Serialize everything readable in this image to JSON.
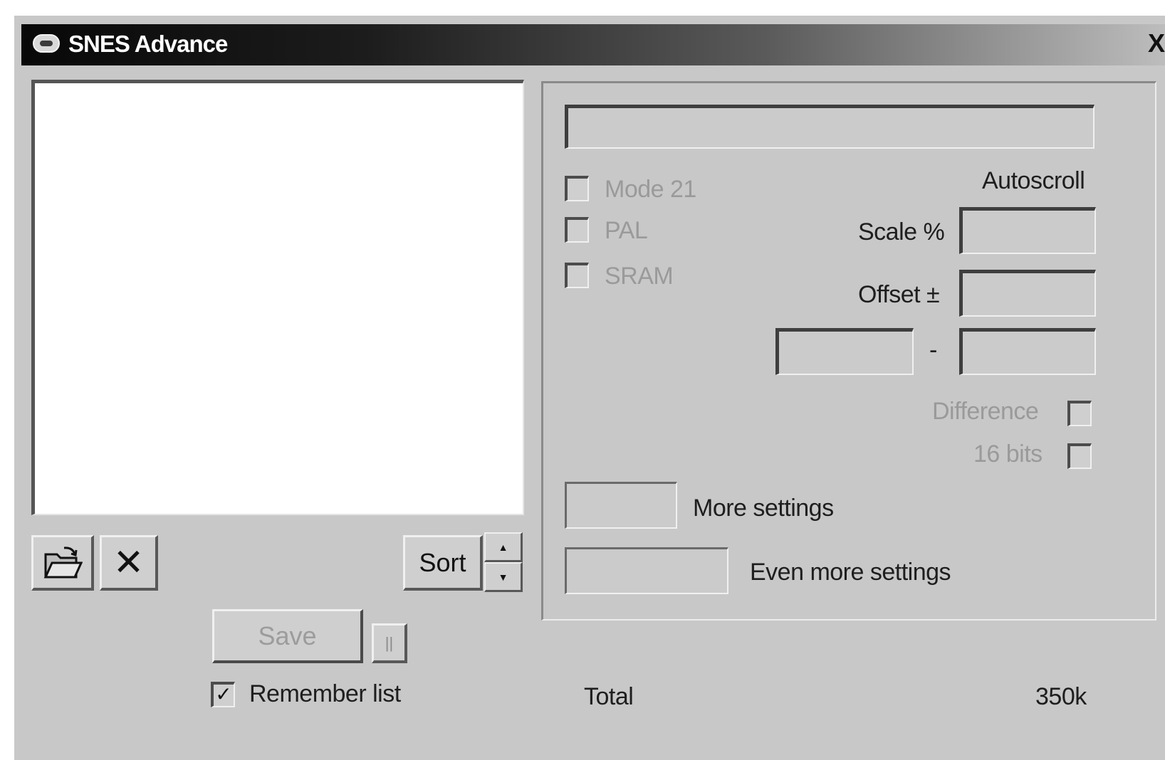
{
  "window": {
    "title": "SNES Advance",
    "close_symbol": "X"
  },
  "toolbar": {
    "open_icon": "open-folder-icon",
    "delete_symbol": "✕",
    "sort_label": "Sort",
    "spin_up": "▲",
    "spin_down": "▼"
  },
  "save_area": {
    "save_label": "Save",
    "pause_symbol": "||",
    "remember_label": "Remember list",
    "remember_checked": true,
    "remember_mark": "✓"
  },
  "footer": {
    "total_label": "Total",
    "total_value": "350k"
  },
  "settings": {
    "status_text": "",
    "checkboxes": [
      {
        "label": "Mode 21",
        "checked": false,
        "enabled": false
      },
      {
        "label": "PAL",
        "checked": false,
        "enabled": false
      },
      {
        "label": "SRAM",
        "checked": false,
        "enabled": false
      }
    ],
    "autoscroll_label": "Autoscroll",
    "scale_label": "Scale %",
    "scale_value": "",
    "offset_label": "Offset ±",
    "offset_value": "",
    "range_from": "",
    "range_separator": "-",
    "range_to": "",
    "difference_label": "Difference",
    "difference_checked": false,
    "bits16_label": "16 bits",
    "bits16_checked": false,
    "more_settings_label": "More settings",
    "more_settings_value": "",
    "even_more_settings_label": "Even more settings",
    "even_more_settings_value": ""
  },
  "colors": {
    "window_bg": "#c8c8c8",
    "title_text": "#ffffff",
    "disabled_text": "#9a9a9a"
  }
}
